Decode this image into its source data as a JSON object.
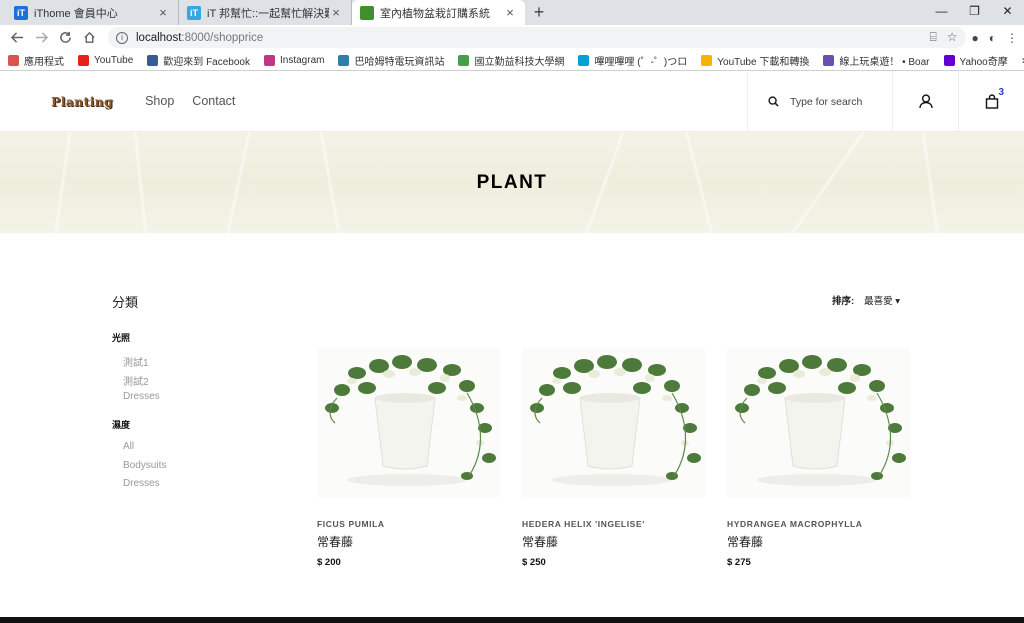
{
  "browser": {
    "tabs": [
      {
        "title": "iThome 會員中心",
        "close": "×",
        "fav_color": "#1e6fd9",
        "fav_text": "iT"
      },
      {
        "title": "iT 邦幫忙::一起幫忙解決難題，拯",
        "close": "×",
        "fav_color": "#38a7e0",
        "fav_text": "iT"
      },
      {
        "title": "室內植物盆栽訂購系統",
        "close": "×",
        "fav_color": "#3f8f2c",
        "fav_text": ""
      }
    ],
    "new_tab": "+",
    "window_controls": [
      "—",
      "❐",
      "✕"
    ],
    "url_host": "localhost",
    "url_path": ":8000/shopprice",
    "bookmarks": [
      {
        "label": "應用程式",
        "color": "#d9534f"
      },
      {
        "label": "YouTube",
        "color": "#e62117"
      },
      {
        "label": "歡迎來到 Facebook",
        "color": "#3b5998"
      },
      {
        "label": "Instagram",
        "color": "#c13584"
      },
      {
        "label": "巴哈姆特電玩資訊站",
        "color": "#2d7fa5"
      },
      {
        "label": "國立勤益科技大學網",
        "color": "#4a9d4a"
      },
      {
        "label": "嗶哩嗶哩 (゜-゜)つロ",
        "color": "#00a1d6"
      },
      {
        "label": "YouTube 下載和轉換",
        "color": "#f5b400"
      },
      {
        "label": "線上玩桌遊！ • Boar",
        "color": "#6a4fb3"
      },
      {
        "label": "Yahoo奇摩",
        "color": "#5f01d1"
      }
    ],
    "more": "»"
  },
  "site": {
    "logo": "Planting",
    "nav": [
      "Shop",
      "Contact"
    ],
    "search_placeholder": "Type for search",
    "cart_count": "3"
  },
  "banner": {
    "title": "PLANT"
  },
  "sidebar": {
    "title": "分類",
    "groups": [
      {
        "heading": "光照",
        "items": [
          "測試1",
          "測試2",
          "Dresses"
        ]
      },
      {
        "heading": "濕度",
        "items": [
          "All",
          "Bodysuits",
          "Dresses"
        ]
      }
    ]
  },
  "sort": {
    "label": "排序:",
    "value": "最喜愛 ▾"
  },
  "products": [
    {
      "latin": "FICUS PUMILA",
      "name": "常春藤",
      "price": "$ 200"
    },
    {
      "latin": "HEDERA HELIX 'INGELISE'",
      "name": "常春藤",
      "price": "$ 250"
    },
    {
      "latin": "HYDRANGEA MACROPHYLLA",
      "name": "常春藤",
      "price": "$ 275"
    }
  ]
}
